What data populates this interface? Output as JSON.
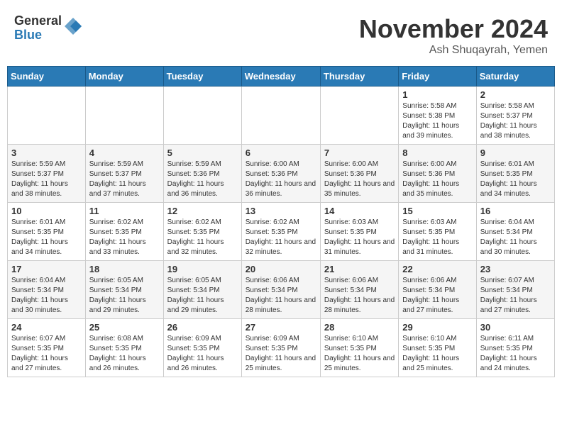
{
  "header": {
    "logo_general": "General",
    "logo_blue": "Blue",
    "month_title": "November 2024",
    "location": "Ash Shuqayrah, Yemen"
  },
  "calendar": {
    "days_of_week": [
      "Sunday",
      "Monday",
      "Tuesday",
      "Wednesday",
      "Thursday",
      "Friday",
      "Saturday"
    ],
    "weeks": [
      [
        {
          "day": "",
          "info": ""
        },
        {
          "day": "",
          "info": ""
        },
        {
          "day": "",
          "info": ""
        },
        {
          "day": "",
          "info": ""
        },
        {
          "day": "",
          "info": ""
        },
        {
          "day": "1",
          "info": "Sunrise: 5:58 AM\nSunset: 5:38 PM\nDaylight: 11 hours and 39 minutes."
        },
        {
          "day": "2",
          "info": "Sunrise: 5:58 AM\nSunset: 5:37 PM\nDaylight: 11 hours and 38 minutes."
        }
      ],
      [
        {
          "day": "3",
          "info": "Sunrise: 5:59 AM\nSunset: 5:37 PM\nDaylight: 11 hours and 38 minutes."
        },
        {
          "day": "4",
          "info": "Sunrise: 5:59 AM\nSunset: 5:37 PM\nDaylight: 11 hours and 37 minutes."
        },
        {
          "day": "5",
          "info": "Sunrise: 5:59 AM\nSunset: 5:36 PM\nDaylight: 11 hours and 36 minutes."
        },
        {
          "day": "6",
          "info": "Sunrise: 6:00 AM\nSunset: 5:36 PM\nDaylight: 11 hours and 36 minutes."
        },
        {
          "day": "7",
          "info": "Sunrise: 6:00 AM\nSunset: 5:36 PM\nDaylight: 11 hours and 35 minutes."
        },
        {
          "day": "8",
          "info": "Sunrise: 6:00 AM\nSunset: 5:36 PM\nDaylight: 11 hours and 35 minutes."
        },
        {
          "day": "9",
          "info": "Sunrise: 6:01 AM\nSunset: 5:35 PM\nDaylight: 11 hours and 34 minutes."
        }
      ],
      [
        {
          "day": "10",
          "info": "Sunrise: 6:01 AM\nSunset: 5:35 PM\nDaylight: 11 hours and 34 minutes."
        },
        {
          "day": "11",
          "info": "Sunrise: 6:02 AM\nSunset: 5:35 PM\nDaylight: 11 hours and 33 minutes."
        },
        {
          "day": "12",
          "info": "Sunrise: 6:02 AM\nSunset: 5:35 PM\nDaylight: 11 hours and 32 minutes."
        },
        {
          "day": "13",
          "info": "Sunrise: 6:02 AM\nSunset: 5:35 PM\nDaylight: 11 hours and 32 minutes."
        },
        {
          "day": "14",
          "info": "Sunrise: 6:03 AM\nSunset: 5:35 PM\nDaylight: 11 hours and 31 minutes."
        },
        {
          "day": "15",
          "info": "Sunrise: 6:03 AM\nSunset: 5:35 PM\nDaylight: 11 hours and 31 minutes."
        },
        {
          "day": "16",
          "info": "Sunrise: 6:04 AM\nSunset: 5:34 PM\nDaylight: 11 hours and 30 minutes."
        }
      ],
      [
        {
          "day": "17",
          "info": "Sunrise: 6:04 AM\nSunset: 5:34 PM\nDaylight: 11 hours and 30 minutes."
        },
        {
          "day": "18",
          "info": "Sunrise: 6:05 AM\nSunset: 5:34 PM\nDaylight: 11 hours and 29 minutes."
        },
        {
          "day": "19",
          "info": "Sunrise: 6:05 AM\nSunset: 5:34 PM\nDaylight: 11 hours and 29 minutes."
        },
        {
          "day": "20",
          "info": "Sunrise: 6:06 AM\nSunset: 5:34 PM\nDaylight: 11 hours and 28 minutes."
        },
        {
          "day": "21",
          "info": "Sunrise: 6:06 AM\nSunset: 5:34 PM\nDaylight: 11 hours and 28 minutes."
        },
        {
          "day": "22",
          "info": "Sunrise: 6:06 AM\nSunset: 5:34 PM\nDaylight: 11 hours and 27 minutes."
        },
        {
          "day": "23",
          "info": "Sunrise: 6:07 AM\nSunset: 5:34 PM\nDaylight: 11 hours and 27 minutes."
        }
      ],
      [
        {
          "day": "24",
          "info": "Sunrise: 6:07 AM\nSunset: 5:35 PM\nDaylight: 11 hours and 27 minutes."
        },
        {
          "day": "25",
          "info": "Sunrise: 6:08 AM\nSunset: 5:35 PM\nDaylight: 11 hours and 26 minutes."
        },
        {
          "day": "26",
          "info": "Sunrise: 6:09 AM\nSunset: 5:35 PM\nDaylight: 11 hours and 26 minutes."
        },
        {
          "day": "27",
          "info": "Sunrise: 6:09 AM\nSunset: 5:35 PM\nDaylight: 11 hours and 25 minutes."
        },
        {
          "day": "28",
          "info": "Sunrise: 6:10 AM\nSunset: 5:35 PM\nDaylight: 11 hours and 25 minutes."
        },
        {
          "day": "29",
          "info": "Sunrise: 6:10 AM\nSunset: 5:35 PM\nDaylight: 11 hours and 25 minutes."
        },
        {
          "day": "30",
          "info": "Sunrise: 6:11 AM\nSunset: 5:35 PM\nDaylight: 11 hours and 24 minutes."
        }
      ]
    ]
  }
}
